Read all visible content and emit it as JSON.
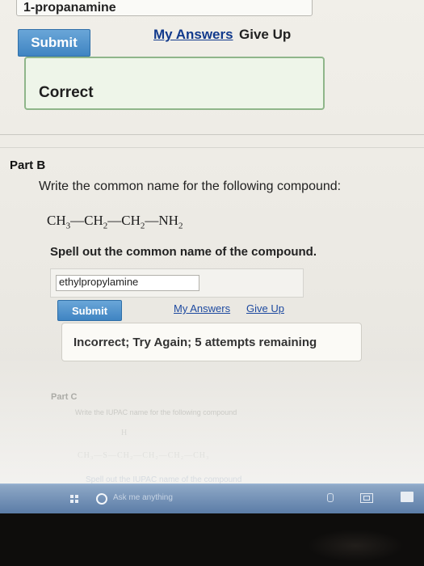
{
  "part_a": {
    "previous_answer": "1-propanamine",
    "submit_label": "Submit",
    "my_answers_label": "My Answers",
    "give_up_label": "Give Up",
    "feedback": "Correct"
  },
  "part_b": {
    "title": "Part B",
    "prompt": "Write the common name for the following compound:",
    "formula_groups": [
      "CH",
      "3",
      "—CH",
      "2",
      "—CH",
      "2",
      "—NH",
      "2"
    ],
    "instruction": "Spell out the common name of the compound.",
    "answer_value": "ethylpropylamine",
    "submit_label": "Submit",
    "my_answers_label": "My Answers",
    "give_up_label": "Give Up",
    "feedback": "Incorrect; Try Again; 5 attempts remaining"
  },
  "part_c": {
    "title": "Part C",
    "prompt": "Write the IUPAC name for the following compound",
    "h_label": "H",
    "formula": "CH₃—S—CH₂—CH₂—CH₂—CH₃",
    "instruction": "Spell out the IUPAC name of the compound"
  },
  "taskbar": {
    "search_placeholder": "Ask me anything"
  },
  "colors": {
    "button_blue": "#3f84c2",
    "link_blue": "#1e4aa0",
    "correct_border": "#8fb68a",
    "taskbar_blue": "#356098"
  }
}
